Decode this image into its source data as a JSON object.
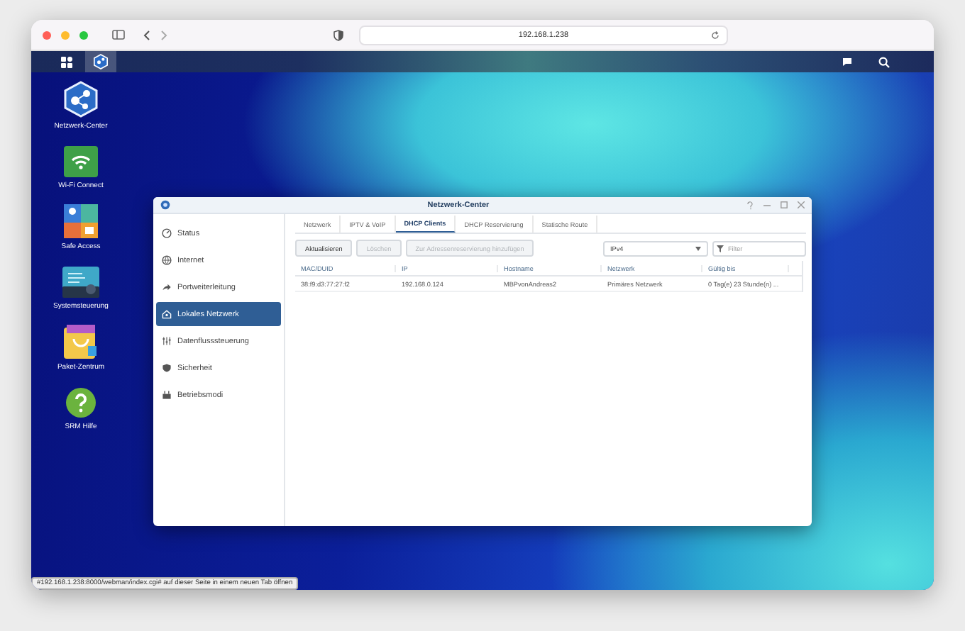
{
  "browser": {
    "address": "192.168.1.238"
  },
  "desktop_icons": [
    {
      "label": "Netzwerk-Center",
      "kind": "network"
    },
    {
      "label": "Wi-Fi Connect",
      "kind": "wifi"
    },
    {
      "label": "Safe Access",
      "kind": "safe"
    },
    {
      "label": "Systemsteuerung",
      "kind": "system"
    },
    {
      "label": "Paket-Zentrum",
      "kind": "package"
    },
    {
      "label": "SRM Hilfe",
      "kind": "help"
    }
  ],
  "window": {
    "title": "Netzwerk-Center",
    "sidebar": [
      {
        "label": "Status",
        "kind": "status",
        "selected": false
      },
      {
        "label": "Internet",
        "kind": "globe",
        "selected": false
      },
      {
        "label": "Portweiterleitung",
        "kind": "forward",
        "selected": false
      },
      {
        "label": "Lokales Netzwerk",
        "kind": "home",
        "selected": true
      },
      {
        "label": "Datenflusssteuerung",
        "kind": "sliders",
        "selected": false
      },
      {
        "label": "Sicherheit",
        "kind": "shield",
        "selected": false
      },
      {
        "label": "Betriebsmodi",
        "kind": "router",
        "selected": false
      }
    ],
    "tabs": [
      {
        "label": "Netzwerk",
        "selected": false
      },
      {
        "label": "IPTV & VoIP",
        "selected": false
      },
      {
        "label": "DHCP Clients",
        "selected": true
      },
      {
        "label": "DHCP Reservierung",
        "selected": false
      },
      {
        "label": "Statische Route",
        "selected": false
      }
    ],
    "buttons": [
      {
        "label": "Aktualisieren",
        "disabled": false
      },
      {
        "label": "Löschen",
        "disabled": true
      },
      {
        "label": "Zur Adressenreservierung hinzufügen",
        "disabled": true
      }
    ],
    "protocol": "IPv4",
    "filter": {
      "placeholder": "Filter"
    },
    "table": {
      "columns": [
        "MAC/DUID",
        "IP",
        "Hostname",
        "Netzwerk",
        "Gültig bis"
      ],
      "rows": [
        [
          "38:f9:d3:77:27:f2",
          "192.168.0.124",
          "MBPvonAndreas2",
          "Primäres Netzwerk",
          "0 Tag(e) 23 Stunde(n) ..."
        ]
      ]
    }
  },
  "status_link": "#192.168.1.238:8000/webman/index.cgi# auf dieser Seite in einem neuen Tab öffnen"
}
